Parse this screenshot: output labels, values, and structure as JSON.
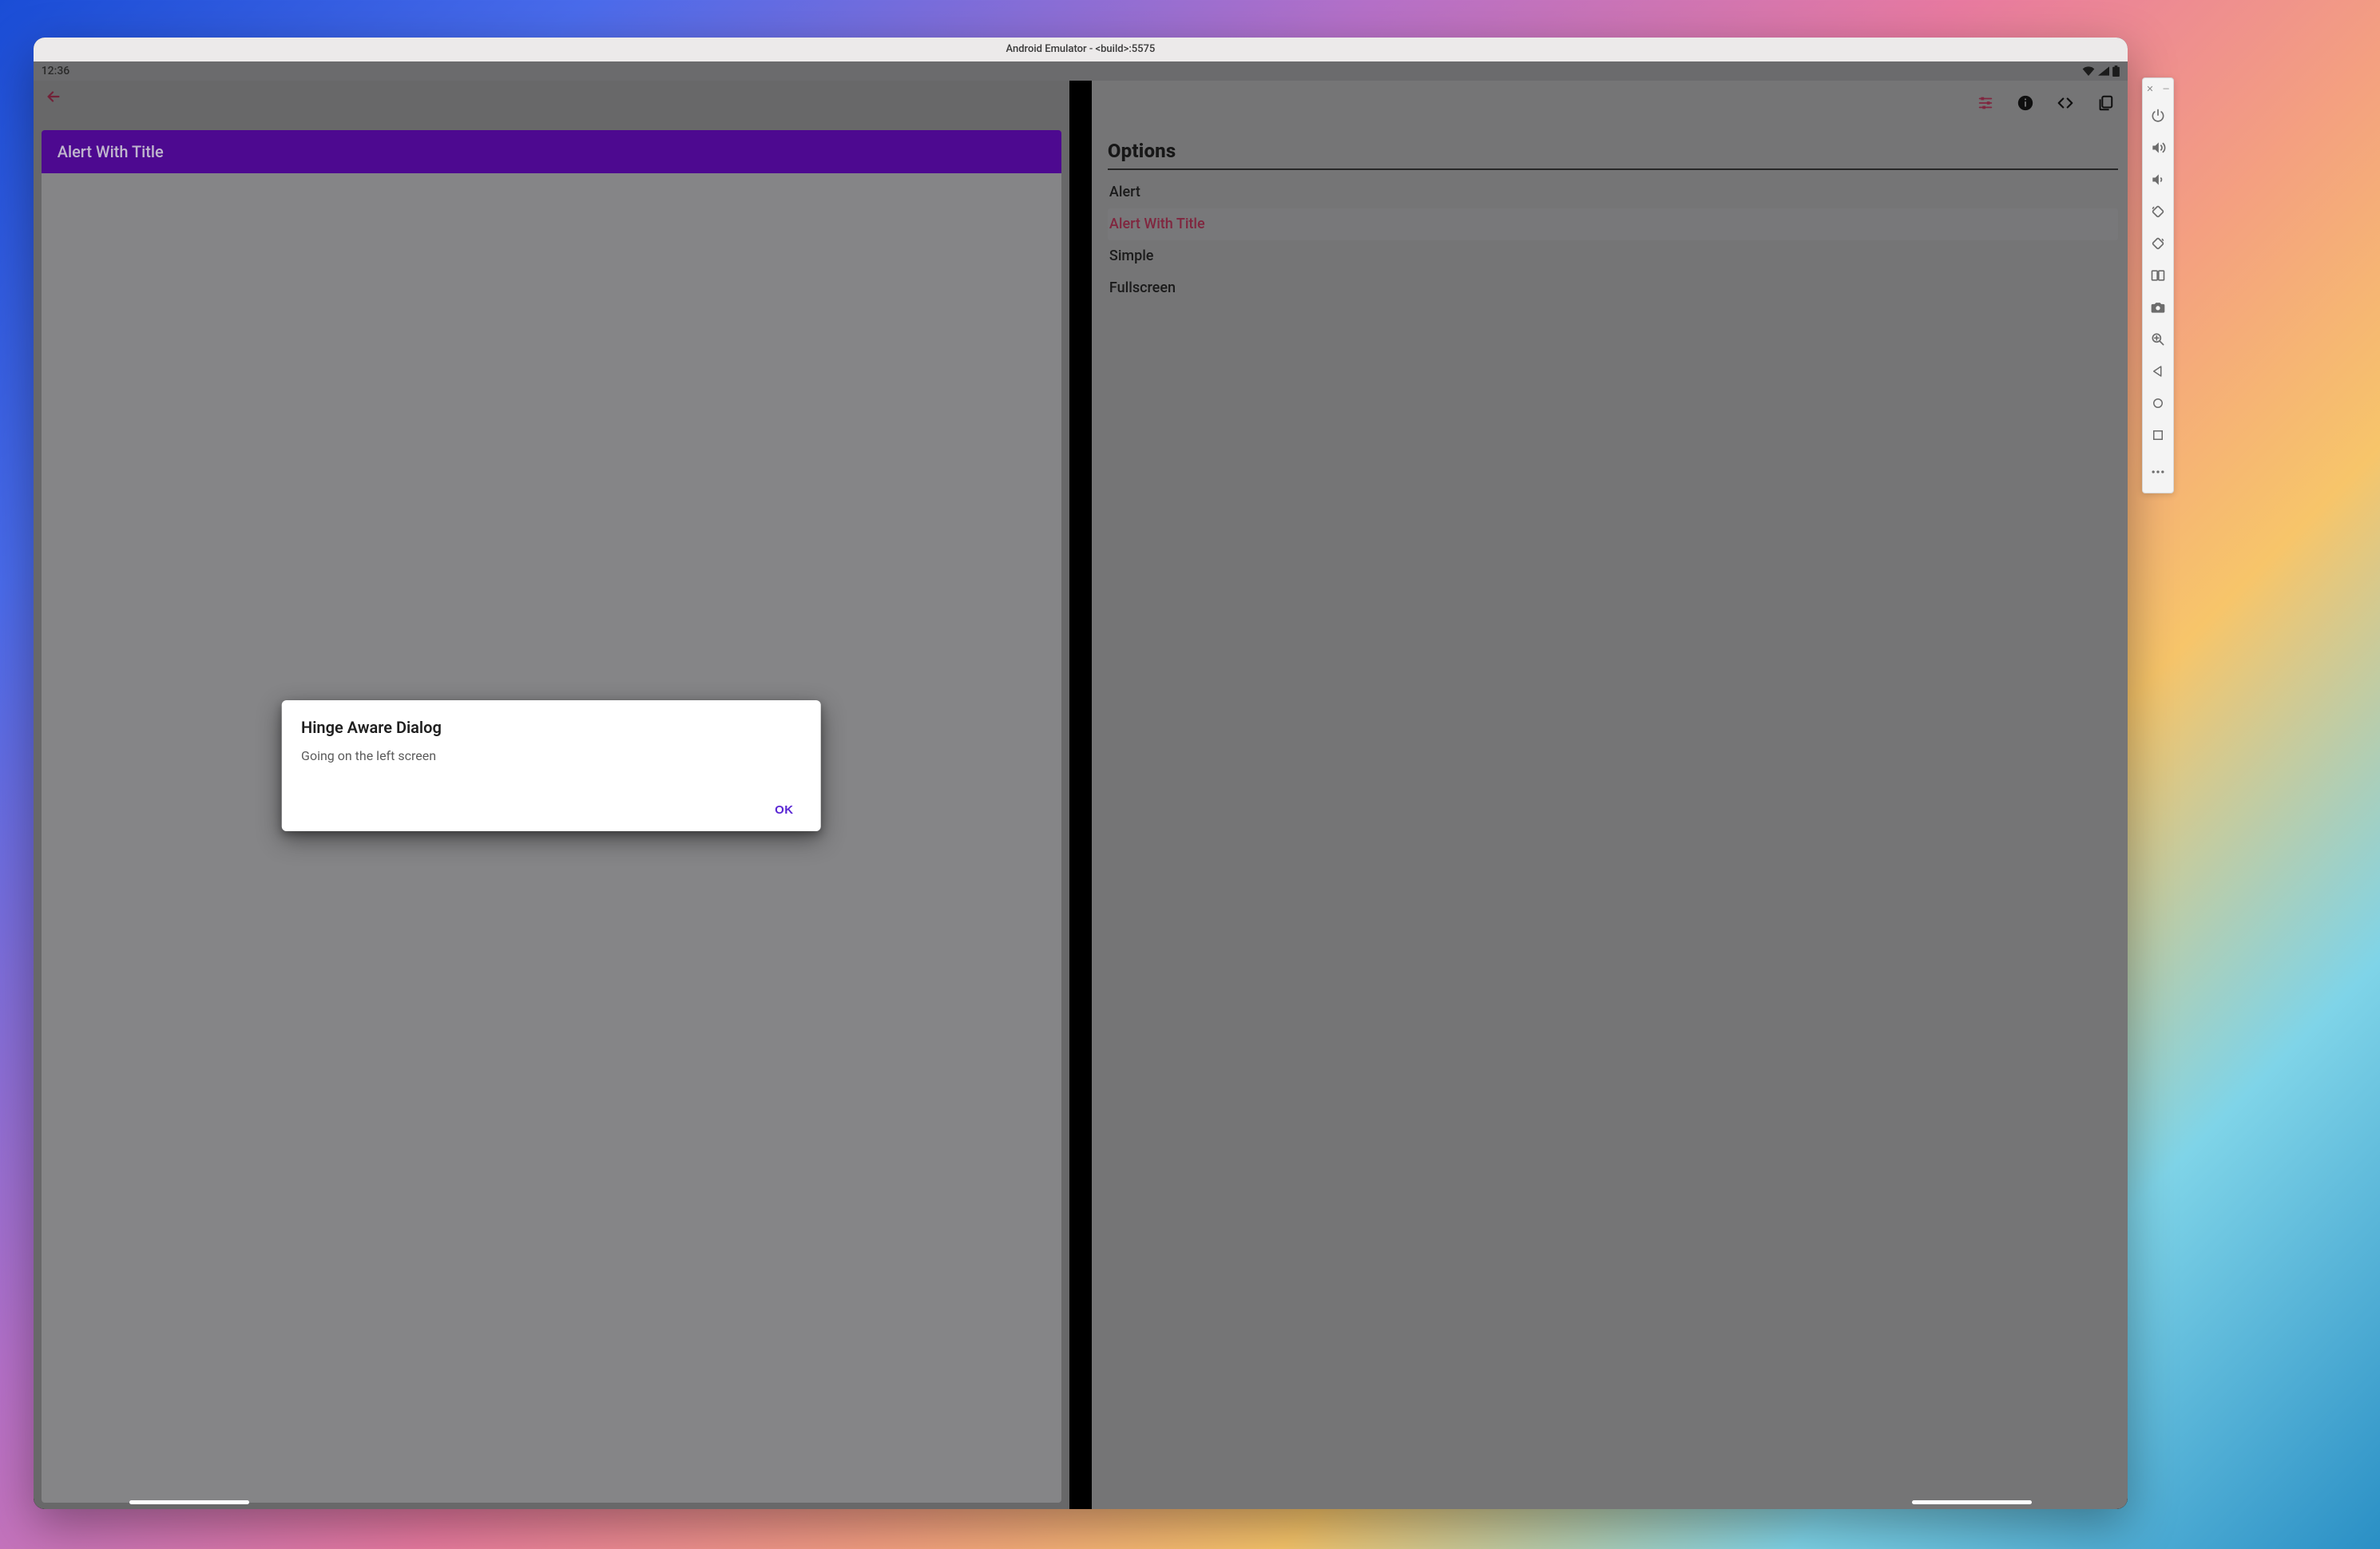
{
  "window": {
    "title": "Android Emulator - <build>:5575"
  },
  "status": {
    "time": "12:36"
  },
  "left": {
    "appbar_title": "Alert With Title"
  },
  "dialog": {
    "title": "Hinge Aware Dialog",
    "message": "Going on the left screen",
    "ok_label": "OK"
  },
  "right": {
    "options_heading": "Options",
    "items": [
      {
        "label": "Alert",
        "selected": false
      },
      {
        "label": "Alert With Title",
        "selected": true
      },
      {
        "label": "Simple",
        "selected": false
      },
      {
        "label": "Fullscreen",
        "selected": false
      }
    ]
  },
  "side_toolbar": [
    "power",
    "volume-up",
    "volume-down",
    "rotate-left",
    "rotate-right",
    "foldable",
    "camera",
    "zoom",
    "back",
    "home",
    "overview",
    "more"
  ]
}
